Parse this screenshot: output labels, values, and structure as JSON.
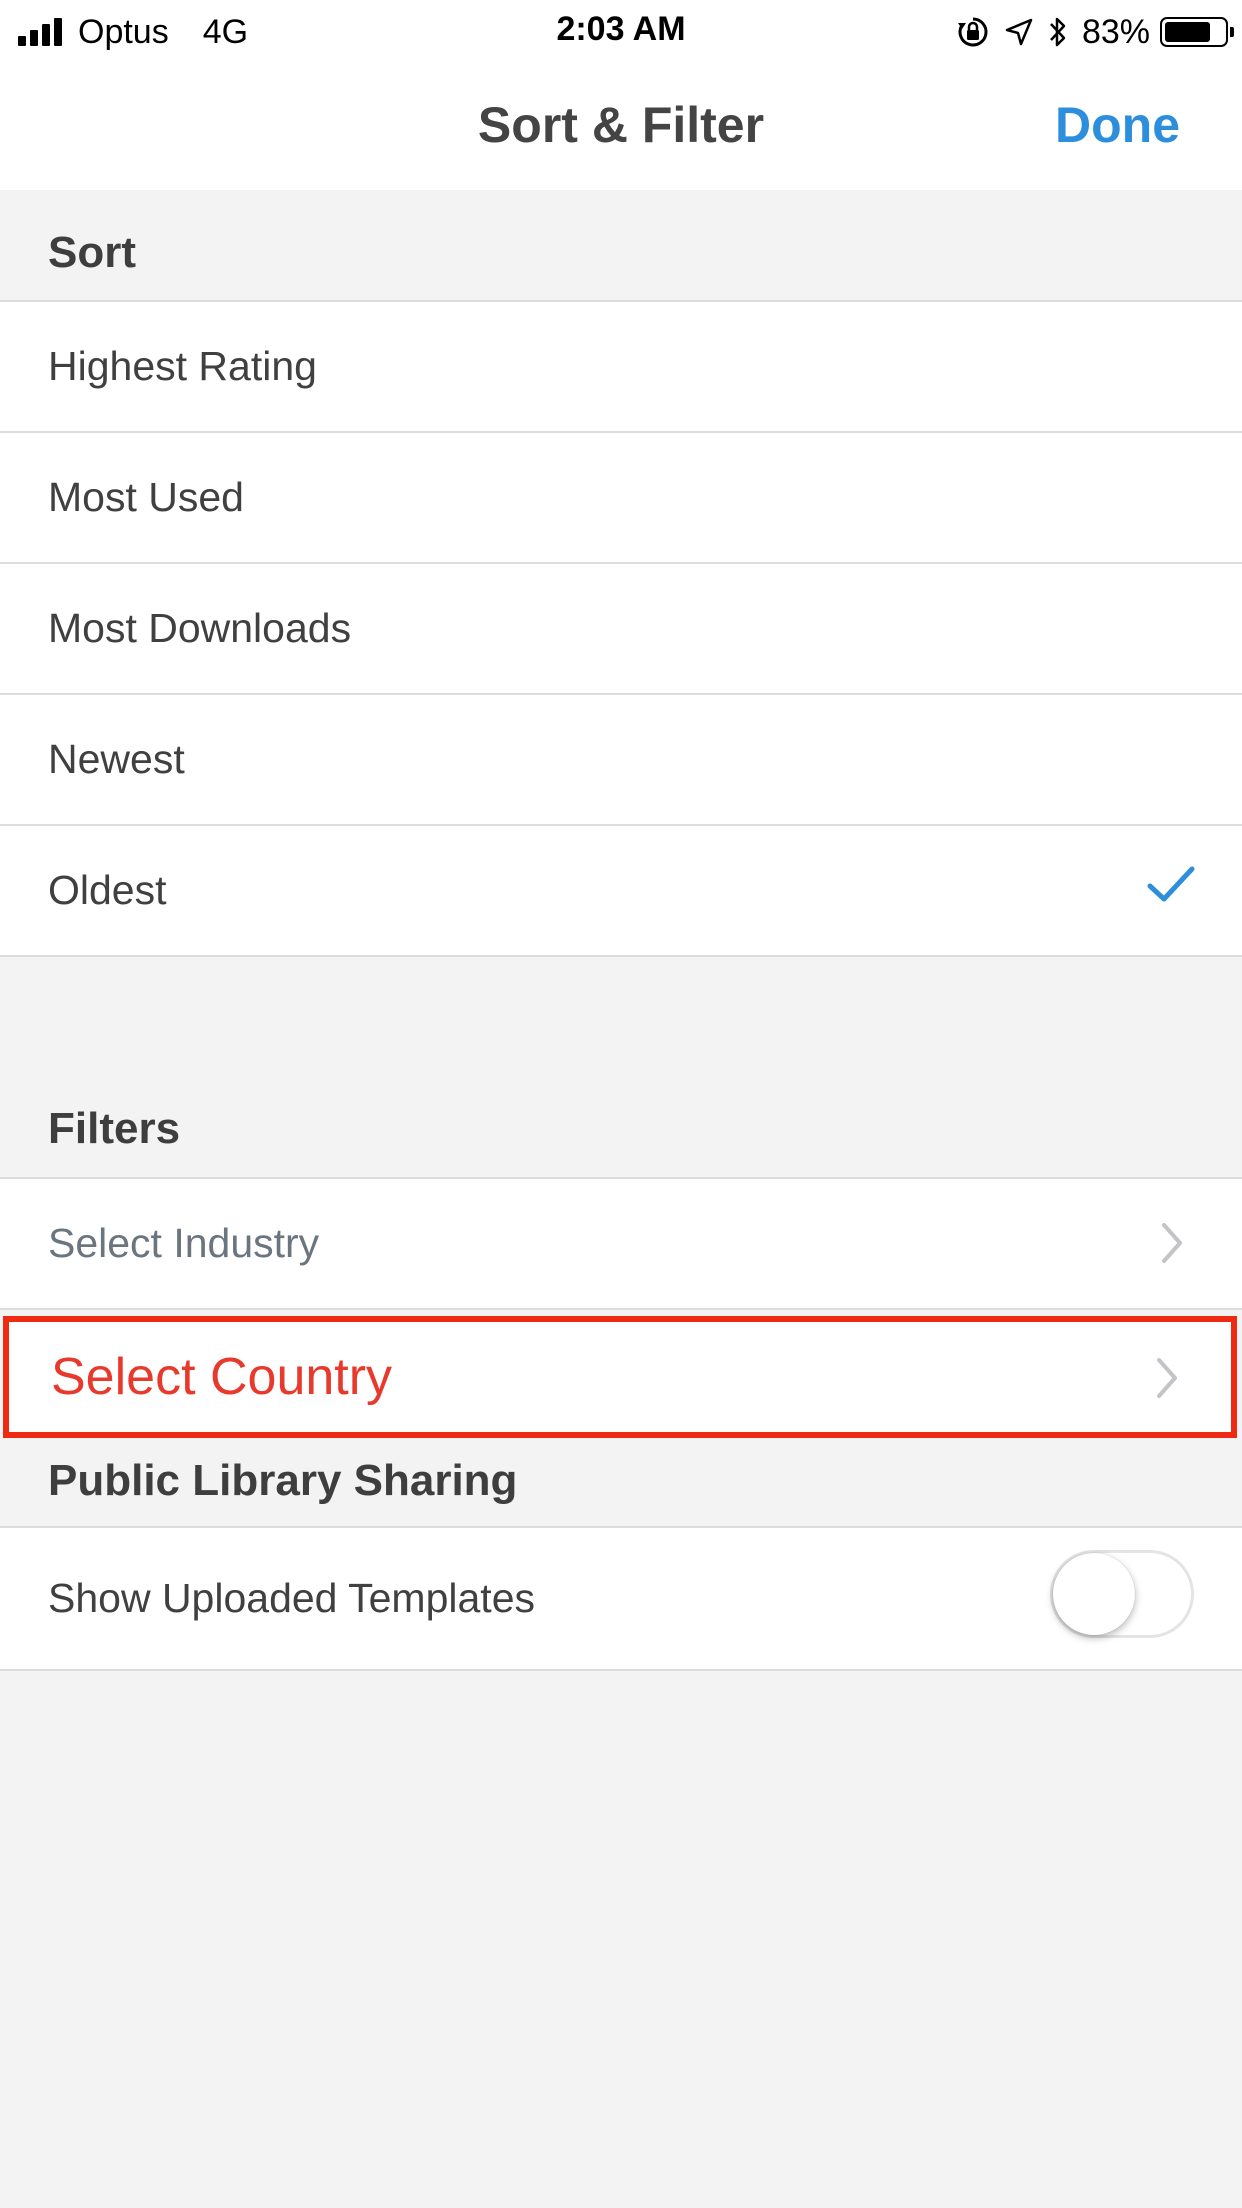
{
  "status_bar": {
    "carrier": "Optus",
    "network": "4G",
    "time": "2:03 AM",
    "battery_percent": "83%",
    "battery_level": 0.83,
    "icons": [
      "signal-icon",
      "orientation-lock-icon",
      "location-icon",
      "bluetooth-icon",
      "battery-icon"
    ]
  },
  "nav": {
    "title": "Sort & Filter",
    "done_label": "Done"
  },
  "sort": {
    "header": "Sort",
    "options": [
      {
        "label": "Highest Rating",
        "selected": false
      },
      {
        "label": "Most Used",
        "selected": false
      },
      {
        "label": "Most Downloads",
        "selected": false
      },
      {
        "label": "Newest",
        "selected": false
      },
      {
        "label": "Oldest",
        "selected": true
      }
    ]
  },
  "filters": {
    "header": "Filters",
    "industry_label": "Select Industry",
    "country_label": "Select Country"
  },
  "sharing": {
    "header": "Public Library Sharing",
    "show_uploaded_label": "Show Uploaded Templates",
    "show_uploaded_on": false
  },
  "colors": {
    "accent": "#2d8fdc",
    "highlight": "#ee2b12",
    "background": "#f3f3f3"
  }
}
